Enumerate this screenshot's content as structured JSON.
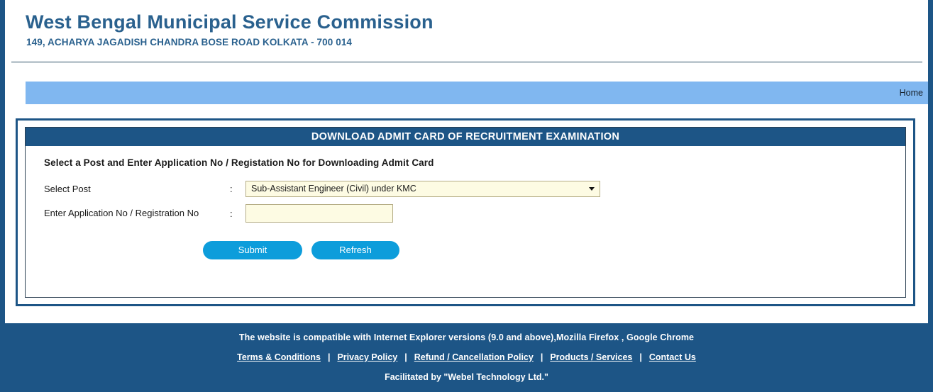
{
  "site": {
    "title": "West Bengal Municipal Service Commission",
    "address": "149, ACHARYA JAGADISH CHANDRA BOSE ROAD KOLKATA - 700 014"
  },
  "nav": {
    "home_label": "Home"
  },
  "panel": {
    "title": "DOWNLOAD ADMIT CARD OF RECRUITMENT EXAMINATION",
    "intro": "Select a Post and Enter Application No / Registation No for Downloading Admit Card",
    "fields": {
      "post": {
        "label": "Select Post",
        "colon": ":",
        "selected": "Sub-Assistant Engineer (Civil) under KMC",
        "options": [
          "Sub-Assistant Engineer (Civil) under KMC"
        ]
      },
      "application": {
        "label": "Enter Application No / Registration No",
        "colon": ":",
        "value": "",
        "placeholder": ""
      }
    },
    "buttons": {
      "submit": "Submit",
      "refresh": "Refresh"
    }
  },
  "footer": {
    "compatibility": "The website is compatible with Internet Explorer versions (9.0 and above),Mozilla Firefox , Google Chrome",
    "links": [
      "Terms & Conditions",
      "Privacy Policy",
      "Refund / Cancellation Policy",
      "Products / Services",
      "Contact Us"
    ],
    "separator": "|",
    "facilitated": "Facilitated by \"Webel Technology Ltd.\""
  },
  "colors": {
    "brand_dark_blue": "#1d5586",
    "header_text_blue": "#2a618e",
    "nav_light_blue": "#80b7f0",
    "button_blue": "#0d9ddb",
    "field_cream": "#fdfbe3"
  }
}
